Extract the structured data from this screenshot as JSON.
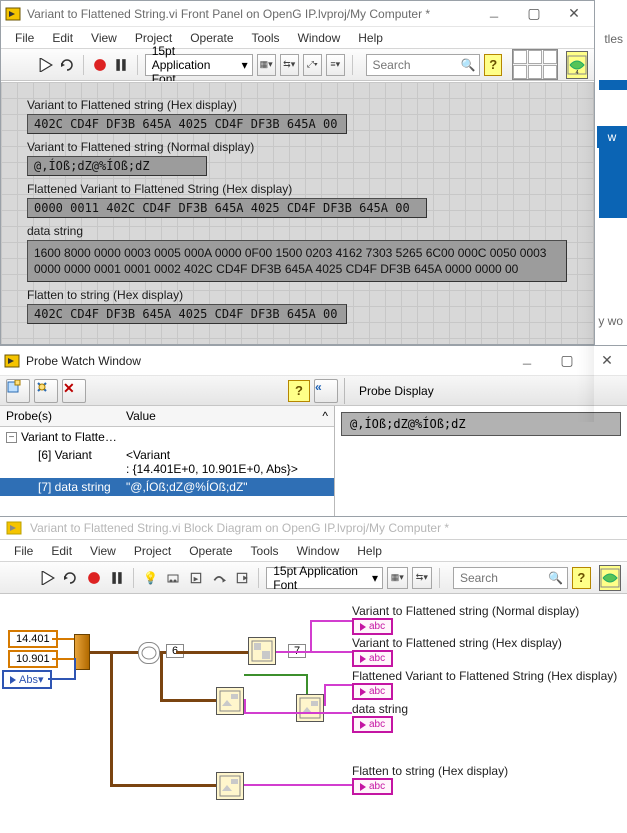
{
  "fp_window": {
    "title": "Variant to Flattened String.vi Front Panel on OpenG IP.lvproj/My Computer *",
    "menus": [
      "File",
      "Edit",
      "View",
      "Project",
      "Operate",
      "Tools",
      "Window",
      "Help"
    ],
    "font_combo": "15pt Application Font",
    "search_placeholder": "Search"
  },
  "fields": {
    "f1_label": "Variant to Flattened string (Hex display)",
    "f1_value": "402C CD4F DF3B 645A 4025 CD4F DF3B 645A 00",
    "f2_label": "Variant to Flattened string (Normal display)",
    "f2_value": "@,ÍOß;dZ@%ÍOß;dZ",
    "f3_label": "Flattened Variant to Flattened String (Hex display)",
    "f3_value": "0000 0011 402C CD4F DF3B 645A 4025 CD4F DF3B 645A 00",
    "f4_label": "data string",
    "f4_value_l1": "1600 8000 0000 0003 0005 000A 0000 0F00 1500 0203 4162 7303 5265 6C00 000C 0050 0003",
    "f4_value_l2": "0000 0000 0001 0001 0002 402C CD4F DF3B 645A 4025 CD4F DF3B 645A 0000 0000 00",
    "f5_label": "Flatten to string  (Hex display)",
    "f5_value": "402C CD4F DF3B 645A 4025 CD4F DF3B 645A 00"
  },
  "probe_window": {
    "title": "Probe Watch Window",
    "columns": [
      "Probe(s)",
      "Value"
    ],
    "root_name": "Variant to Flattened String.vi",
    "rows": [
      {
        "name": "[6] Variant",
        "value_l1": "<Variant",
        "value_l2": ": {14.401E+0, 10.901E+0, Abs}>"
      },
      {
        "name": "[7] data string",
        "value": "\"@,ÍOß;dZ@%ÍOß;dZ\""
      }
    ],
    "display_header": "Probe Display",
    "display_value": "@,ÍOß;dZ@%ÍOß;dZ"
  },
  "bd_window": {
    "title": "Variant to Flattened String.vi Block Diagram on OpenG IP.lvproj/My Computer *",
    "menus": [
      "File",
      "Edit",
      "View",
      "Project",
      "Operate",
      "Tools",
      "Window",
      "Help"
    ],
    "font_combo": "15pt Application Font",
    "search_placeholder": "Search"
  },
  "constants": {
    "c1": "14.401",
    "c2": "10.901",
    "c3": "Abs",
    "p6": "6",
    "p7": "7"
  },
  "bd_labels": {
    "l1": "Variant to Flattened string (Normal display)",
    "l2": "Variant to Flattened string (Hex display)",
    "l3": "Flattened Variant to Flattened String  (Hex display)",
    "l4": "data string",
    "l5": "Flatten to string  (Hex display)"
  },
  "ind_text": {
    "abc": "abc"
  },
  "background": {
    "tab_letter": "w",
    "truncated_titles": "tles",
    "truncated_ywo": "y wo"
  }
}
